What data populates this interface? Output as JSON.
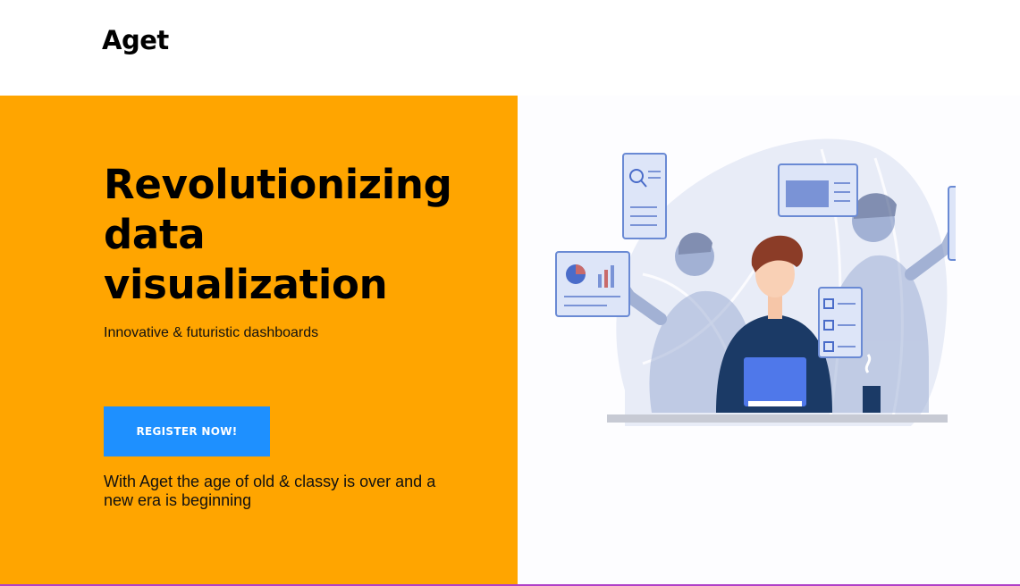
{
  "header": {
    "logo": "Aget"
  },
  "hero": {
    "title": "Revolutionizing data visualization",
    "subtitle": "Innovative & futuristic dashboards",
    "cta_label": "REGISTER NOW!",
    "tagline": "With Aget the age of old & classy is over and a new era is beginning"
  },
  "colors": {
    "hero_background": "#ffa500",
    "cta_background": "#1e90ff",
    "illustration_accent": "#3b5fcf"
  },
  "illustration": {
    "icon": "team-analytics-illustration"
  }
}
